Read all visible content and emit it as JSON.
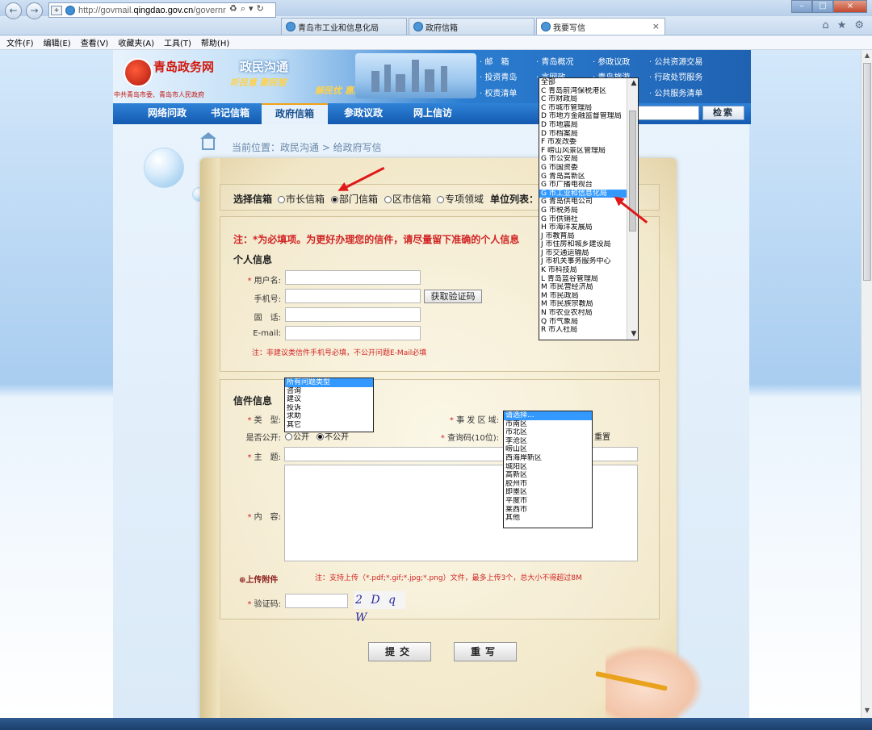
{
  "browser": {
    "address_url_prefix": "http://govmail.",
    "address_url_domain": "qingdao.gov.cn",
    "address_url_suffix": "/governr",
    "tabs": [
      "青岛市工业和信息化局",
      "政府信箱",
      "我要写信"
    ],
    "tab_close": "×",
    "menu": [
      "文件(F)",
      "编辑(E)",
      "查看(V)",
      "收藏夹(A)",
      "工具(T)",
      "帮助(H)"
    ],
    "window_buttons": [
      "–",
      "□",
      "×"
    ]
  },
  "site": {
    "logo_title": "青岛政务网",
    "logo_sub": "中共青岛市委、青岛市人民政府",
    "slogan_main": "政民沟通",
    "slogan_left": "听民意 聚民智",
    "slogan_right": "解民忧 惠民生",
    "quick_links": [
      "· 邮　箱",
      "· 青岛概况",
      "· 参政议政",
      "· 公共资源交易",
      "· 投资青岛",
      "· 言网政",
      "· 青岛旅游",
      "· 行政处罚服务",
      "· 权责清单",
      "",
      "· 项",
      "· 公共服务清单"
    ],
    "nav": [
      "网络问政",
      "书记信箱",
      "政府信箱",
      "参政议政",
      "网上信访"
    ],
    "search_label": "检索"
  },
  "breadcrumb": "当前位置：政民沟通 > 给政府写信",
  "mailbox": {
    "label": "选择信箱",
    "options": [
      "市长信箱",
      "部门信箱",
      "区市信箱",
      "专项领域"
    ],
    "selected": "部门信箱",
    "unit_label": "单位列表："
  },
  "notice": "注：*为必填项。为更好办理您的信件，请尽量留下准确的个人信息",
  "personal": {
    "heading": "个人信息",
    "username_label": "用户名:",
    "phone_label": "手机号:",
    "tel_label": "固　话:",
    "email_label": "E-mail:",
    "get_code_button": "获取验证码",
    "hint": "注：非建议类信件手机号必填，不公开问题E-Mail必填"
  },
  "letter": {
    "heading": "信件信息",
    "type_label": "类　型:",
    "public_label": "是否公开:",
    "public_options": [
      "公开",
      "不公开"
    ],
    "public_selected": "不公开",
    "area_label": "事 发 区 域:",
    "query_label": "查询码(10位):",
    "query_tail": "重置",
    "subject_label": "主　题:",
    "content_label": "内　容:",
    "attach_label": "⊕上传附件",
    "attach_hint": "注：支持上传（*.pdf;*.gif;*.jpg;*.png）文件，最多上传3个，总大小不得超过8M",
    "captcha_label": "验证码:",
    "captcha_text": "2 D q W"
  },
  "type_list": [
    "所有问题类型",
    "咨询",
    "建议",
    "投诉",
    "求助",
    "其它"
  ],
  "area_list": [
    "请选择...",
    "市南区",
    "市北区",
    "李沧区",
    "崂山区",
    "西海岸新区",
    "城阳区",
    "高新区",
    "胶州市",
    "即墨区",
    "平度市",
    "莱西市",
    "其他"
  ],
  "unit_list": [
    "全部",
    "C 青岛前湾保税港区",
    "C 市财政局",
    "C 市城市管理局",
    "D 市地方金融监督管理局",
    "D 市地震局",
    "D 市档案局",
    "F 市发改委",
    "F 崂山风景区管理局",
    "G 市公安局",
    "G 市国资委",
    "G 青岛高新区",
    "G 市广播电视台",
    "G 市工业和信息化局",
    "G 青岛供电公司",
    "G 市税务局",
    "G 市供销社",
    "H 市海洋发展局",
    "J 市教育局",
    "J 市住房和城乡建设局",
    "J 市交通运输局",
    "J 市机关事务服务中心",
    "K 市科技局",
    "L 青岛蓝谷管理局",
    "M 市民营经济局",
    "M 市民政局",
    "M 市民族宗教局",
    "N 市农业农村局",
    "Q 市气象局",
    "R 市人社局"
  ],
  "unit_highlighted": "G 市工业和信息化局",
  "buttons": {
    "submit": "提交",
    "reset": "重写"
  },
  "colors": {
    "accent": "#135ab0",
    "required": "#d12424",
    "selection": "#3399ff",
    "paper": "#f1e6c6"
  }
}
